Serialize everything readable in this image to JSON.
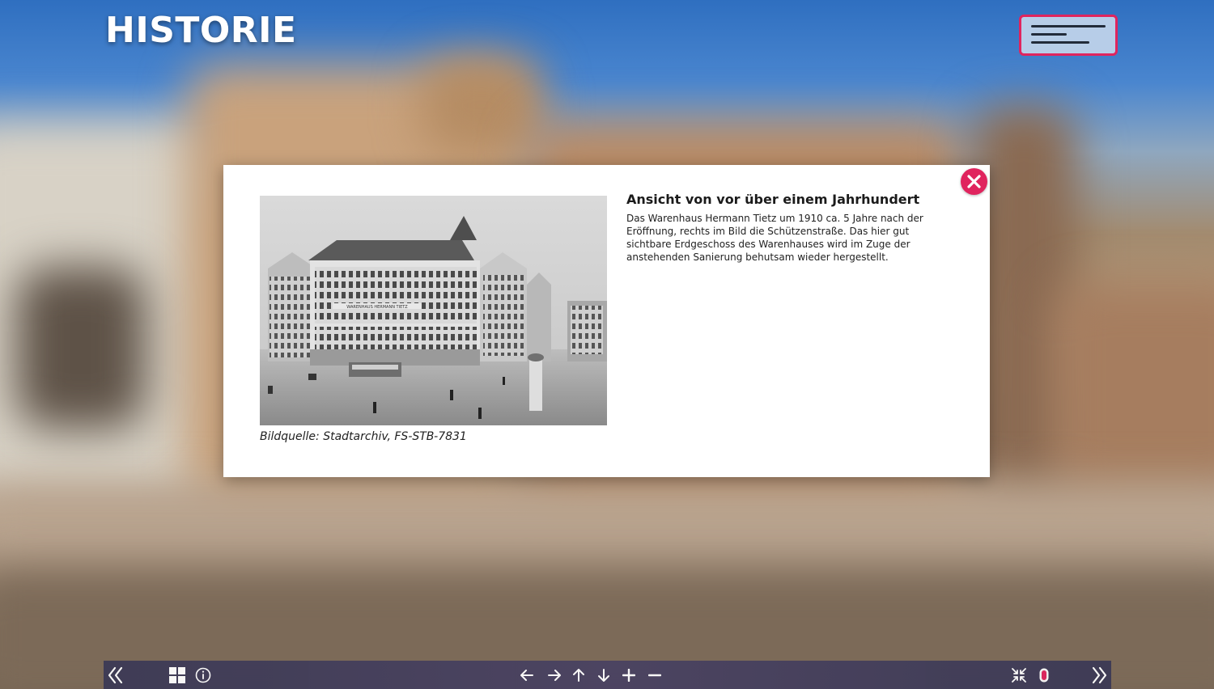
{
  "header": {
    "title": "HISTORIE",
    "menu_icon": "hamburger-menu-icon"
  },
  "modal": {
    "close_icon": "close-icon",
    "image_alt": "Warenhaus Hermann Tietz um 1910",
    "image_sign": "WARENHAUS HERMANN TIETZ",
    "caption": "Bildquelle: Stadtarchiv, FS-STB-7831",
    "heading": "Ansicht von vor über einem Jahrhundert",
    "body": "Das Warenhaus Hermann Tietz um 1910 ca. 5 Jahre nach der Eröffnung, rechts im Bild die Schützenstraße. Das hier gut sichtbare Erdgeschoss des Warenhauses wird im Zuge der anstehenden Sanierung behutsam wieder hergestellt."
  },
  "toolbar": {
    "buttons": [
      {
        "name": "previous-scene",
        "icon": "double-chevron-left-icon"
      },
      {
        "name": "thumbnails",
        "icon": "grid-icon"
      },
      {
        "name": "info",
        "icon": "info-icon"
      },
      {
        "name": "pan-left",
        "icon": "arrow-left-icon"
      },
      {
        "name": "pan-right",
        "icon": "arrow-right-icon"
      },
      {
        "name": "pan-up",
        "icon": "arrow-up-icon"
      },
      {
        "name": "pan-down",
        "icon": "arrow-down-icon"
      },
      {
        "name": "zoom-in",
        "icon": "plus-icon"
      },
      {
        "name": "zoom-out",
        "icon": "minus-icon"
      },
      {
        "name": "exit-fullscreen",
        "icon": "compress-icon"
      },
      {
        "name": "mouse-mode",
        "icon": "mouse-icon"
      },
      {
        "name": "next-scene",
        "icon": "double-chevron-right-icon"
      }
    ]
  },
  "colors": {
    "accent": "#e0245e",
    "menu_bg": "#b7cde8",
    "toolbar_bg": "#3c3a55"
  }
}
